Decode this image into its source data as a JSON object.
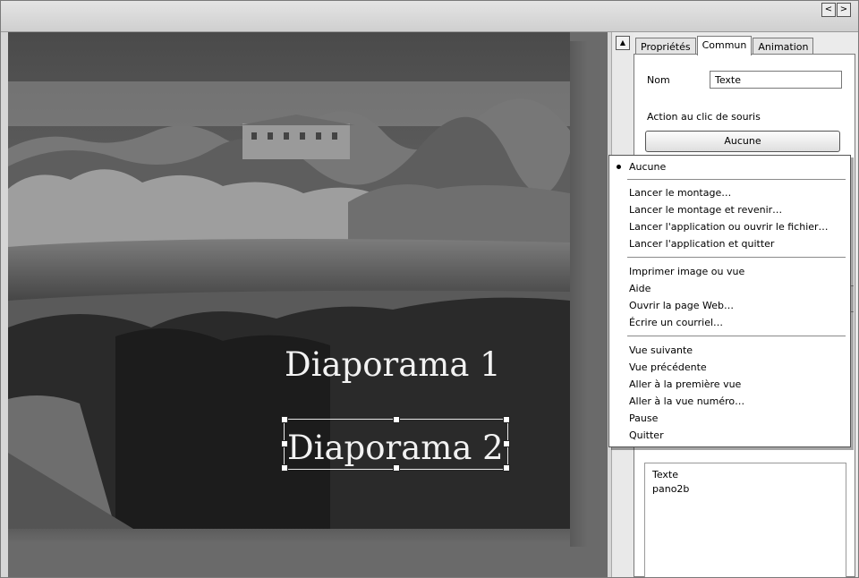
{
  "nav": {
    "prev": "<",
    "next": ">"
  },
  "slide": {
    "title1": "Diaporama 1",
    "title2": "Diaporama 2"
  },
  "panel": {
    "tabs": [
      "Propriétés",
      "Commun",
      "Animation"
    ],
    "active_tab": "Commun",
    "name_label": "Nom",
    "name_value": "Texte",
    "action_label": "Action au clic de souris",
    "action_value": "Aucune",
    "objects": [
      "Texte",
      "pano2b"
    ]
  },
  "menu": {
    "selected": "Aucune",
    "items": [
      "Aucune",
      "Lancer le montage…",
      "Lancer le montage et revenir…",
      "Lancer l'application ou ouvrir le fichier…",
      "Lancer l'application et quitter",
      "Imprimer image ou vue",
      "Aide",
      "Ouvrir la page Web…",
      "Écrire un courriel…",
      "Vue suivante",
      "Vue précédente",
      "Aller à la première vue",
      "Aller à la vue numéro…",
      "Pause",
      "Quitter"
    ]
  },
  "icons": {
    "scroll_up": "up-arrow-icon",
    "nav_prev": "left-arrow-icon",
    "nav_next": "right-arrow-icon"
  }
}
